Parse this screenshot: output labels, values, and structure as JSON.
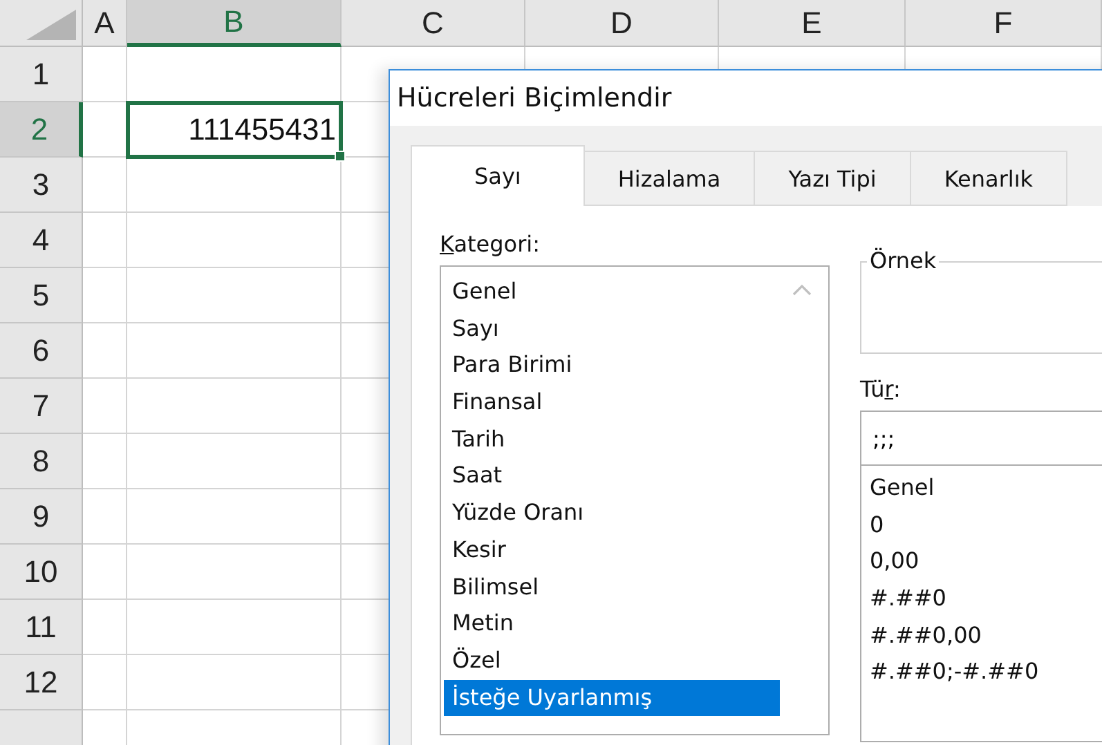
{
  "sheet": {
    "columns": [
      {
        "label": "A",
        "selected": false
      },
      {
        "label": "B",
        "selected": true
      },
      {
        "label": "C",
        "selected": false
      },
      {
        "label": "D",
        "selected": false
      },
      {
        "label": "E",
        "selected": false
      },
      {
        "label": "F",
        "selected": false
      }
    ],
    "rows": [
      {
        "label": "1",
        "selected": false
      },
      {
        "label": "2",
        "selected": true
      },
      {
        "label": "3",
        "selected": false
      },
      {
        "label": "4",
        "selected": false
      },
      {
        "label": "5",
        "selected": false
      },
      {
        "label": "6",
        "selected": false
      },
      {
        "label": "7",
        "selected": false
      },
      {
        "label": "8",
        "selected": false
      },
      {
        "label": "9",
        "selected": false
      },
      {
        "label": "10",
        "selected": false
      },
      {
        "label": "11",
        "selected": false
      },
      {
        "label": "12",
        "selected": false
      }
    ],
    "active_cell": {
      "value": "111455431"
    }
  },
  "dialog": {
    "title": "Hücreleri Biçimlendir",
    "tabs": [
      {
        "label": "Sayı",
        "selected": true
      },
      {
        "label": "Hizalama",
        "selected": false
      },
      {
        "label": "Yazı Tipi",
        "selected": false
      },
      {
        "label": "Kenarlık",
        "selected": false
      }
    ],
    "category": {
      "label": "Kategori:",
      "items": [
        {
          "label": "Genel",
          "selected": false
        },
        {
          "label": "Sayı",
          "selected": false
        },
        {
          "label": "Para Birimi",
          "selected": false
        },
        {
          "label": "Finansal",
          "selected": false
        },
        {
          "label": "Tarih",
          "selected": false
        },
        {
          "label": "Saat",
          "selected": false
        },
        {
          "label": "Yüzde Oranı",
          "selected": false
        },
        {
          "label": "Kesir",
          "selected": false
        },
        {
          "label": "Bilimsel",
          "selected": false
        },
        {
          "label": "Metin",
          "selected": false
        },
        {
          "label": "Özel",
          "selected": false
        },
        {
          "label": "İsteğe Uyarlanmış",
          "selected": true
        }
      ]
    },
    "sample": {
      "label": "Örnek"
    },
    "type": {
      "label": "Tür:",
      "value": ";;;",
      "items": [
        {
          "label": "Genel"
        },
        {
          "label": "0"
        },
        {
          "label": "0,00"
        },
        {
          "label": "#.##0"
        },
        {
          "label": "#.##0,00"
        },
        {
          "label": "#.##0;-#.##0"
        }
      ]
    }
  }
}
